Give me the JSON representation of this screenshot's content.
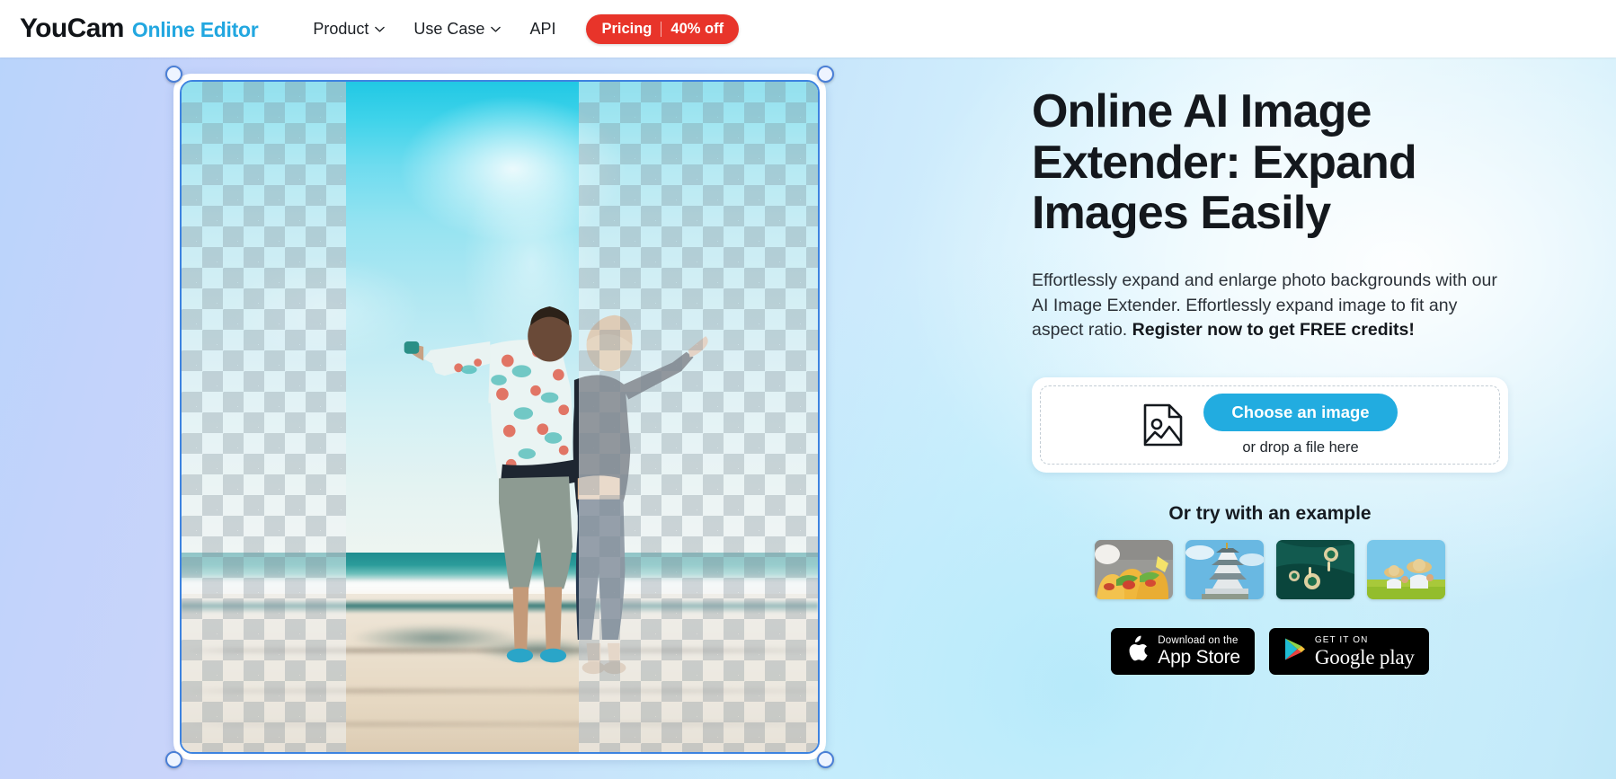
{
  "header": {
    "logo_primary": "YouCam",
    "logo_secondary": "Online Editor",
    "nav": [
      {
        "label": "Product",
        "has_chevron": true,
        "icon": "chevron-down-icon"
      },
      {
        "label": "Use Case",
        "has_chevron": true,
        "icon": "chevron-down-icon"
      },
      {
        "label": "API",
        "has_chevron": false,
        "icon": ""
      }
    ],
    "pricing": {
      "label": "Pricing",
      "discount": "40% off",
      "color": "#e8342a"
    }
  },
  "editor": {
    "name": "image-extender-canvas",
    "photo_alt": "Couple embracing on a beach with arms outstretched under a blue sky",
    "transparency_pattern": "checkerboard",
    "handles": [
      "top-left",
      "top-right",
      "bottom-left",
      "bottom-right"
    ],
    "selection_border_color": "#3d83e0"
  },
  "hero": {
    "title": "Online AI Image Extender: Expand Images Easily",
    "desc_part1": "Effortlessly expand and enlarge photo backgrounds with our AI Image Extender. Effortlessly expand image to fit any aspect ratio. ",
    "desc_bold": "Register now to get FREE credits!"
  },
  "upload": {
    "icon": "image-file-icon",
    "button_label": "Choose an image",
    "drop_label": "or drop a file here",
    "button_color": "#22ace0"
  },
  "examples": {
    "title": "Or try with an example",
    "thumbnails": [
      {
        "name": "example-thumb-tacos",
        "alt": "Tacos on a plate"
      },
      {
        "name": "example-thumb-castle",
        "alt": "Japanese castle"
      },
      {
        "name": "example-thumb-jewelry",
        "alt": "Emerald earrings on green silk"
      },
      {
        "name": "example-thumb-kids",
        "alt": "Two children in straw hats on grass"
      }
    ]
  },
  "stores": {
    "apple": {
      "small": "Download on the",
      "big": "App Store",
      "icon": "apple-icon"
    },
    "google": {
      "small": "GET IT ON",
      "big": "Google",
      "big2": " play",
      "icon": "google-play-icon"
    }
  }
}
